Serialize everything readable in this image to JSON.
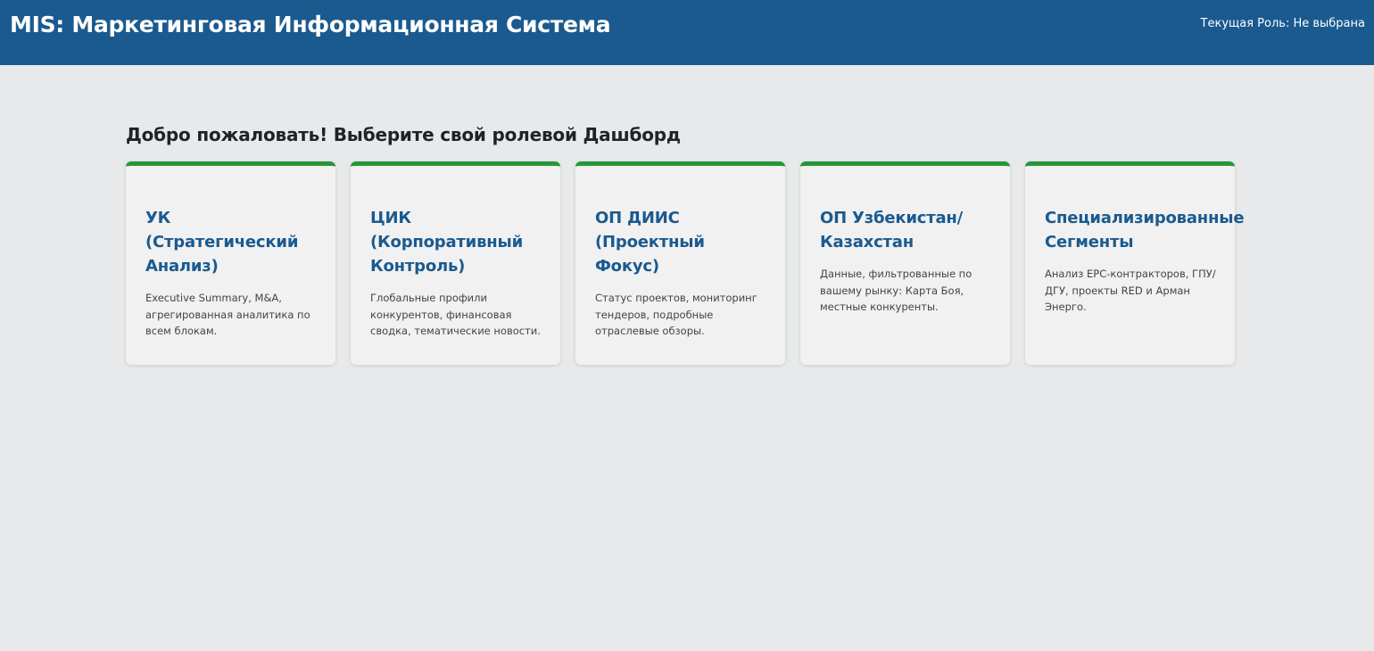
{
  "header": {
    "title": "MIS: Маркетинговая Информационная Система",
    "current_role": "Текущая Роль: Не выбрана"
  },
  "main": {
    "welcome": "Добро пожаловать! Выберите свой ролевой Дашборд",
    "cards": [
      {
        "title": "УК (Стратегический Анализ)",
        "description": "Executive Summary, M&A, агрегированная аналитика по всем блокам."
      },
      {
        "title": "ЦИК (Корпоративный Контроль)",
        "description": "Глобальные профили конкурентов, финансовая сводка, тематические новости."
      },
      {
        "title": "ОП ДИИС (Проектный Фокус)",
        "description": "Статус проектов, мониторинг тендеров, подробные отраслевые обзоры."
      },
      {
        "title": "ОП Узбекистан/ Казахстан",
        "description": "Данные, фильтрованные по вашему рынку: Карта Боя, местные конкуренты."
      },
      {
        "title": "Специализированные Сегменты",
        "description": "Анализ EPC-контракторов, ГПУ/ДГУ, проекты RED и Арман Энерго."
      }
    ]
  },
  "colors": {
    "header_bg": "#1a5a8f",
    "accent_green": "#28963c",
    "card_title": "#1a5a8f",
    "page_bg": "#e8e9ea"
  }
}
